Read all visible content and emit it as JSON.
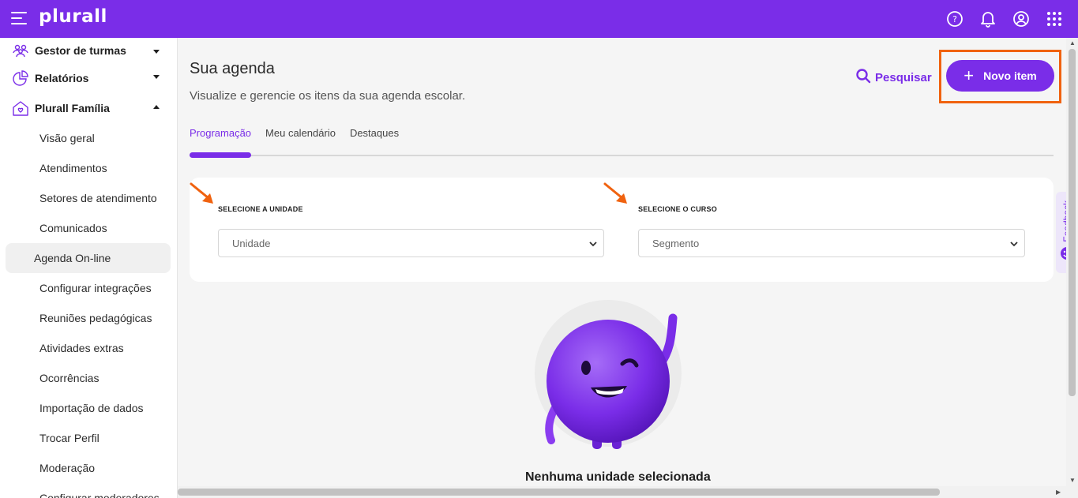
{
  "app": {
    "logo_text": "plurall"
  },
  "colors": {
    "brand": "#7a2de8",
    "highlight": "#f0620f"
  },
  "topbar": {
    "icons": [
      "help-icon",
      "bell-icon",
      "user-icon",
      "apps-grid-icon"
    ]
  },
  "sidebar": {
    "groups": [
      {
        "label": "Gestor de turmas",
        "icon": "people-icon",
        "expanded": false
      },
      {
        "label": "Relatórios",
        "icon": "chart-icon",
        "expanded": false
      },
      {
        "label": "Plurall Família",
        "icon": "family-home-icon",
        "expanded": true
      }
    ],
    "items": [
      "Visão geral",
      "Atendimentos",
      "Setores de atendimento",
      "Comunicados",
      "Agenda On-line",
      "Configurar integrações",
      "Reuniões pedagógicas",
      "Atividades extras",
      "Ocorrências",
      "Importação de dados",
      "Trocar Perfil",
      "Moderação",
      "Configurar moderadores"
    ],
    "active_item": "Agenda On-line"
  },
  "main": {
    "title": "Sua agenda",
    "subtitle": "Visualize e gerencie os itens da sua agenda escolar.",
    "search_label": "Pesquisar",
    "new_item_label": "Novo item",
    "tabs": [
      "Programação",
      "Meu calendário",
      "Destaques"
    ],
    "active_tab": "Programação",
    "filters": {
      "unit_label": "SELECIONE A UNIDADE",
      "unit_placeholder": "Unidade",
      "course_label": "SELECIONE O CURSO",
      "course_placeholder": "Segmento"
    },
    "empty_state": "Nenhuma unidade selecionada"
  },
  "feedback_label": "Feedback"
}
